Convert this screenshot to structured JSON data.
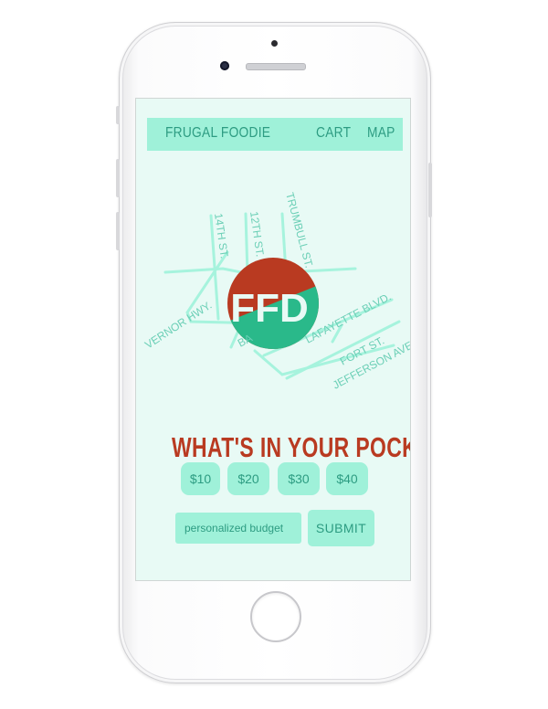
{
  "nav": {
    "brand": "FRUGAL FOODIE",
    "cart": "CART",
    "map": "MAP"
  },
  "map": {
    "logo_text": "FFD",
    "logo_colors": {
      "red": "#b93a21",
      "green": "#2ab98a",
      "letters": "#e8faf5"
    },
    "streets": {
      "s14th": "14TH ST.",
      "s12th": "12TH ST.",
      "trumbull": "TRUMBULL ST.",
      "vernor": "VERNOR HWY.",
      "ba": "BA",
      "lafayette": "LAFAYETTE BLVD.",
      "fort": "FORT ST.",
      "jefferson": "JEFFERSON AVE."
    }
  },
  "headline": "WHAT'S IN YOUR POCKET?",
  "amounts": [
    "$10",
    "$20",
    "$30",
    "$40"
  ],
  "budget": {
    "placeholder": "personalized budget"
  },
  "submit": "SUBMIT",
  "colors": {
    "screen_bg": "#e8faf5",
    "mint": "#9ff1d9",
    "teal_text": "#2d9c82",
    "headline": "#b93a21"
  }
}
